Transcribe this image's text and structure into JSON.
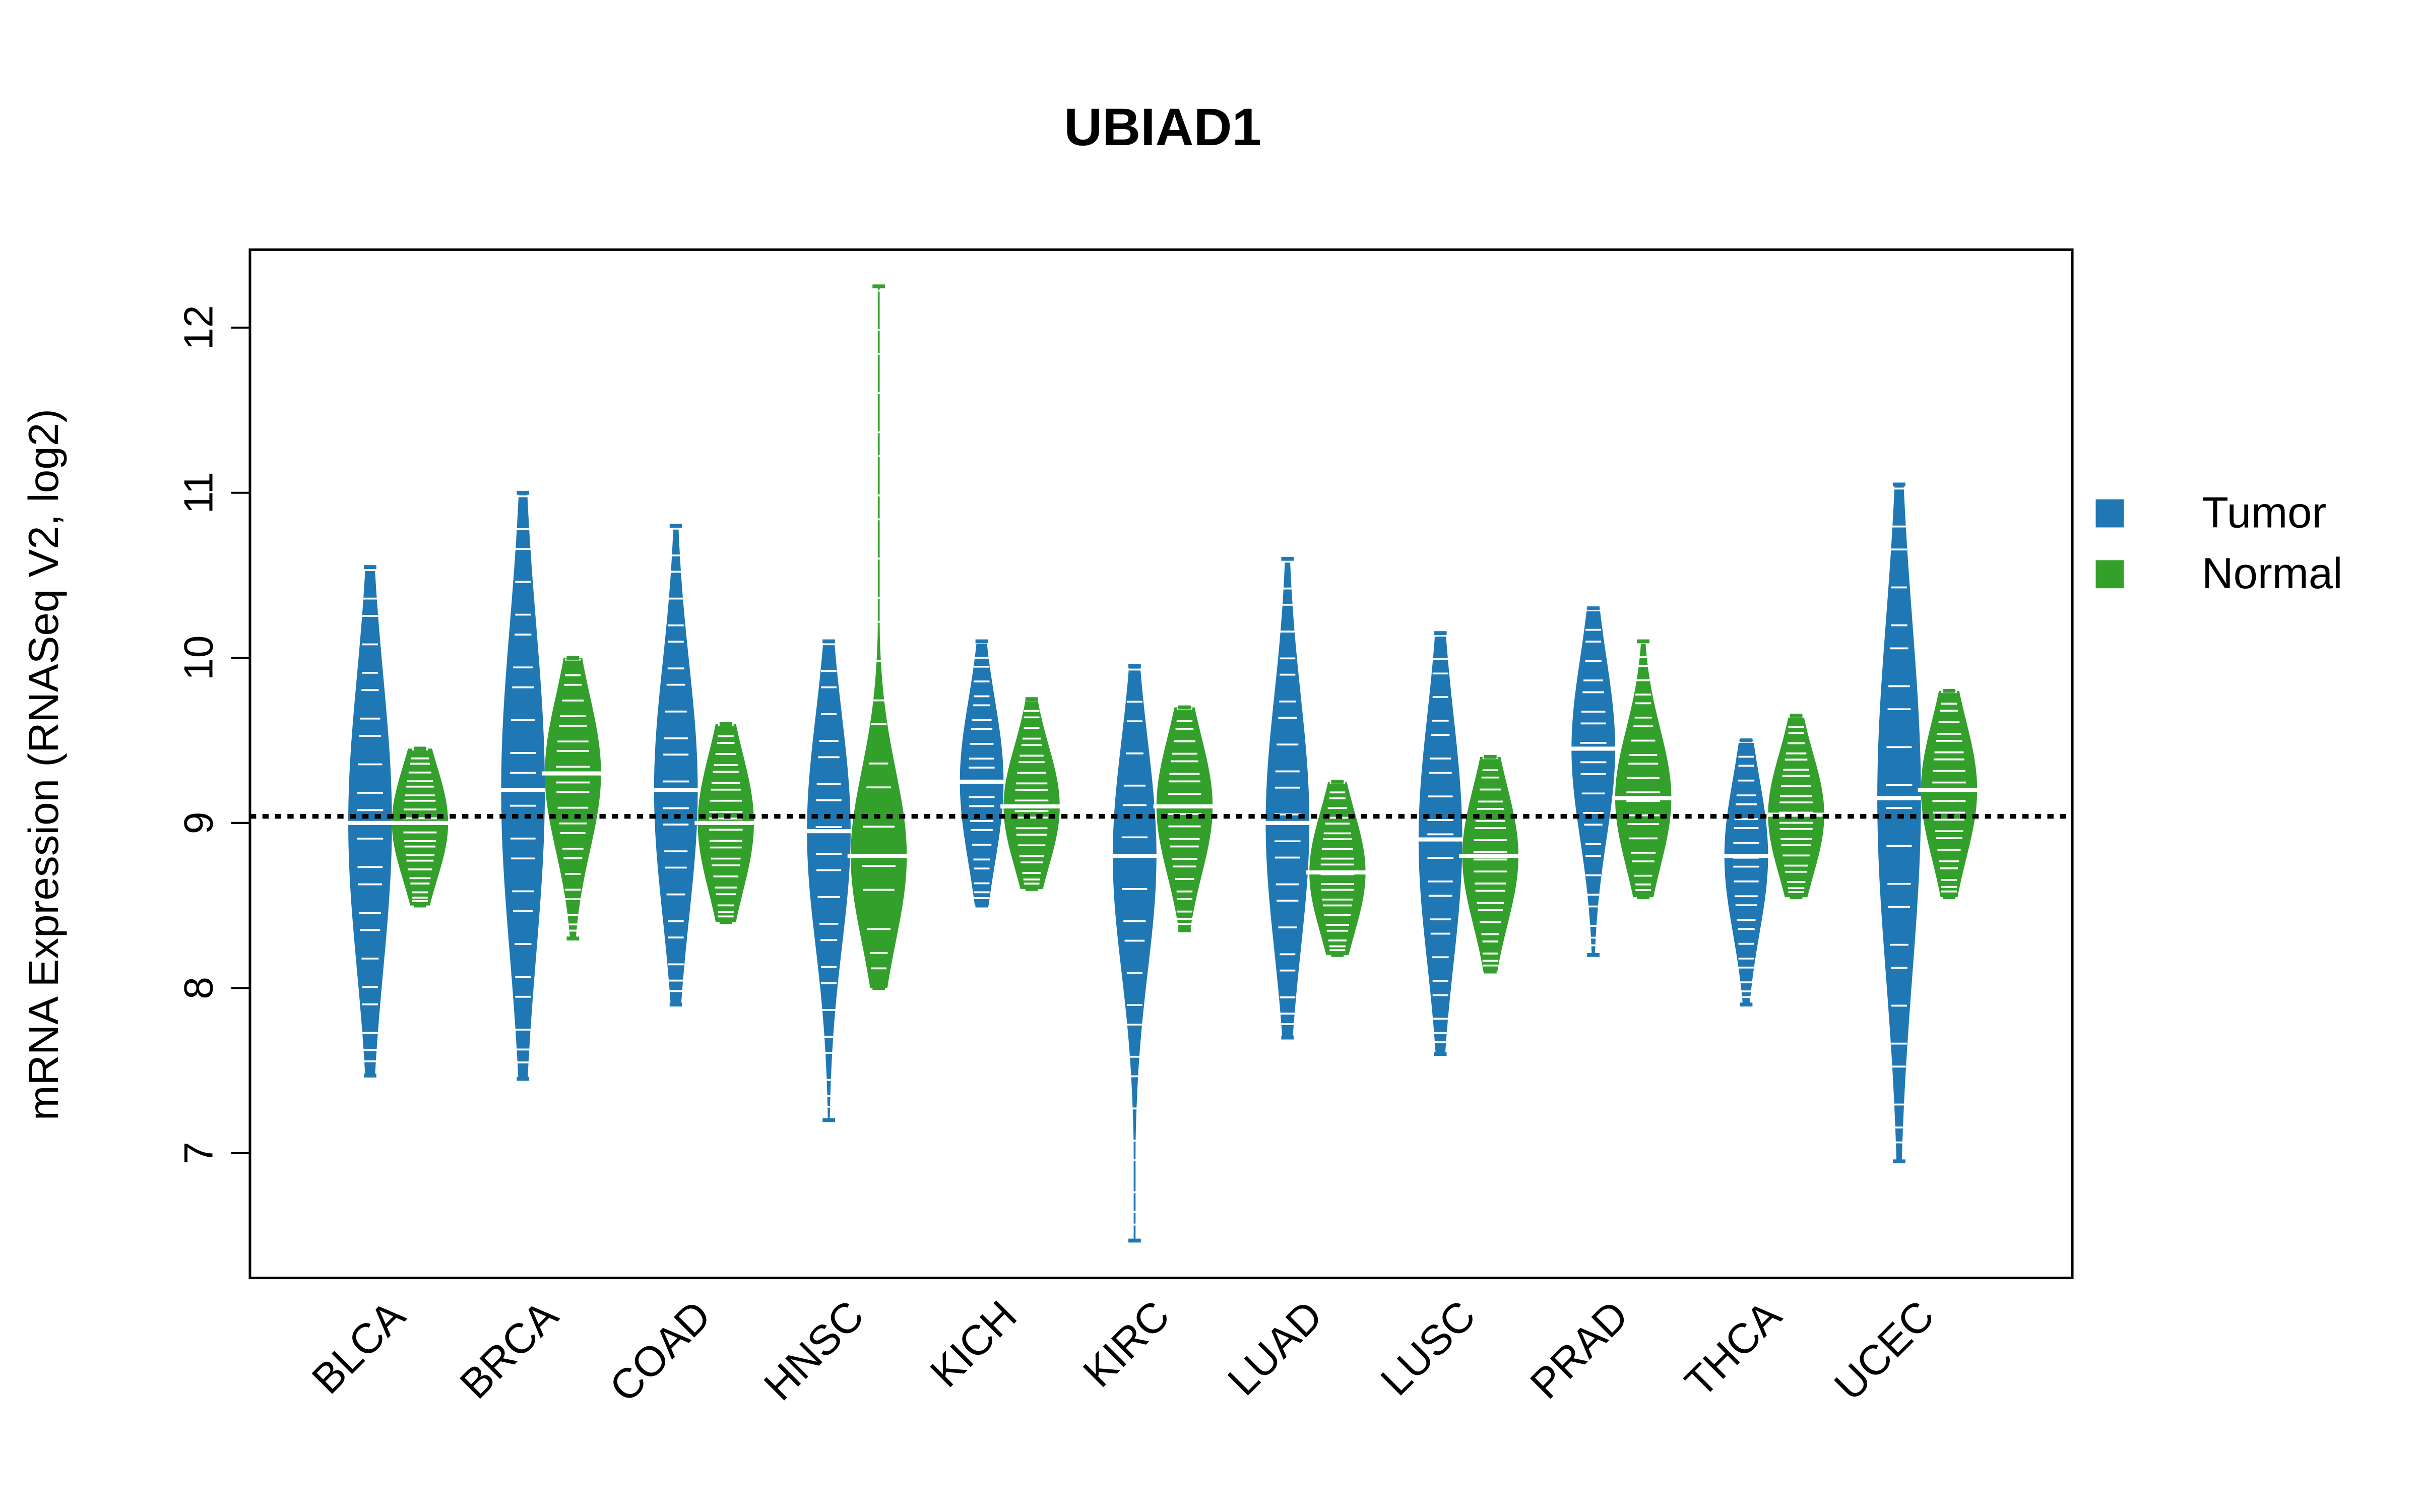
{
  "chart_data": {
    "type": "beanplot",
    "title": "UBIAD1",
    "xlabel": "",
    "ylabel": "mRNA Expression (RNASeq V2, log2)",
    "ylim": [
      6.3,
      12.5
    ],
    "yticks": [
      7,
      8,
      9,
      10,
      11,
      12
    ],
    "reference_line": 9.04,
    "legend": {
      "position": "right",
      "entries": [
        {
          "name": "Tumor",
          "color": "#1F78B4"
        },
        {
          "name": "Normal",
          "color": "#33A02C"
        }
      ]
    },
    "categories": [
      "BLCA",
      "BRCA",
      "COAD",
      "HNSC",
      "KICH",
      "KIRC",
      "LUAD",
      "LUSC",
      "PRAD",
      "THCA",
      "UCEC"
    ],
    "series": [
      {
        "name": "Tumor",
        "color": "#1F78B4",
        "median": [
          9.0,
          9.2,
          9.2,
          8.95,
          9.25,
          8.8,
          9.0,
          8.9,
          9.45,
          8.8,
          9.15
        ],
        "min": [
          7.47,
          7.45,
          7.9,
          7.2,
          8.5,
          6.47,
          7.7,
          7.6,
          8.2,
          7.9,
          6.95
        ],
        "max": [
          10.55,
          11.0,
          10.8,
          10.1,
          10.1,
          9.95,
          10.6,
          10.15,
          10.3,
          9.5,
          11.05
        ]
      },
      {
        "name": "Normal",
        "color": "#33A02C",
        "median": [
          9.0,
          9.3,
          9.0,
          8.8,
          9.1,
          9.1,
          8.7,
          8.8,
          9.15,
          9.05,
          9.2
        ],
        "min": [
          8.5,
          8.3,
          8.4,
          8.0,
          8.6,
          8.35,
          8.2,
          8.1,
          8.55,
          8.55,
          8.55
        ],
        "max": [
          9.45,
          10.0,
          9.6,
          12.25,
          9.75,
          9.7,
          9.25,
          9.4,
          10.1,
          9.65,
          9.8
        ]
      }
    ]
  }
}
